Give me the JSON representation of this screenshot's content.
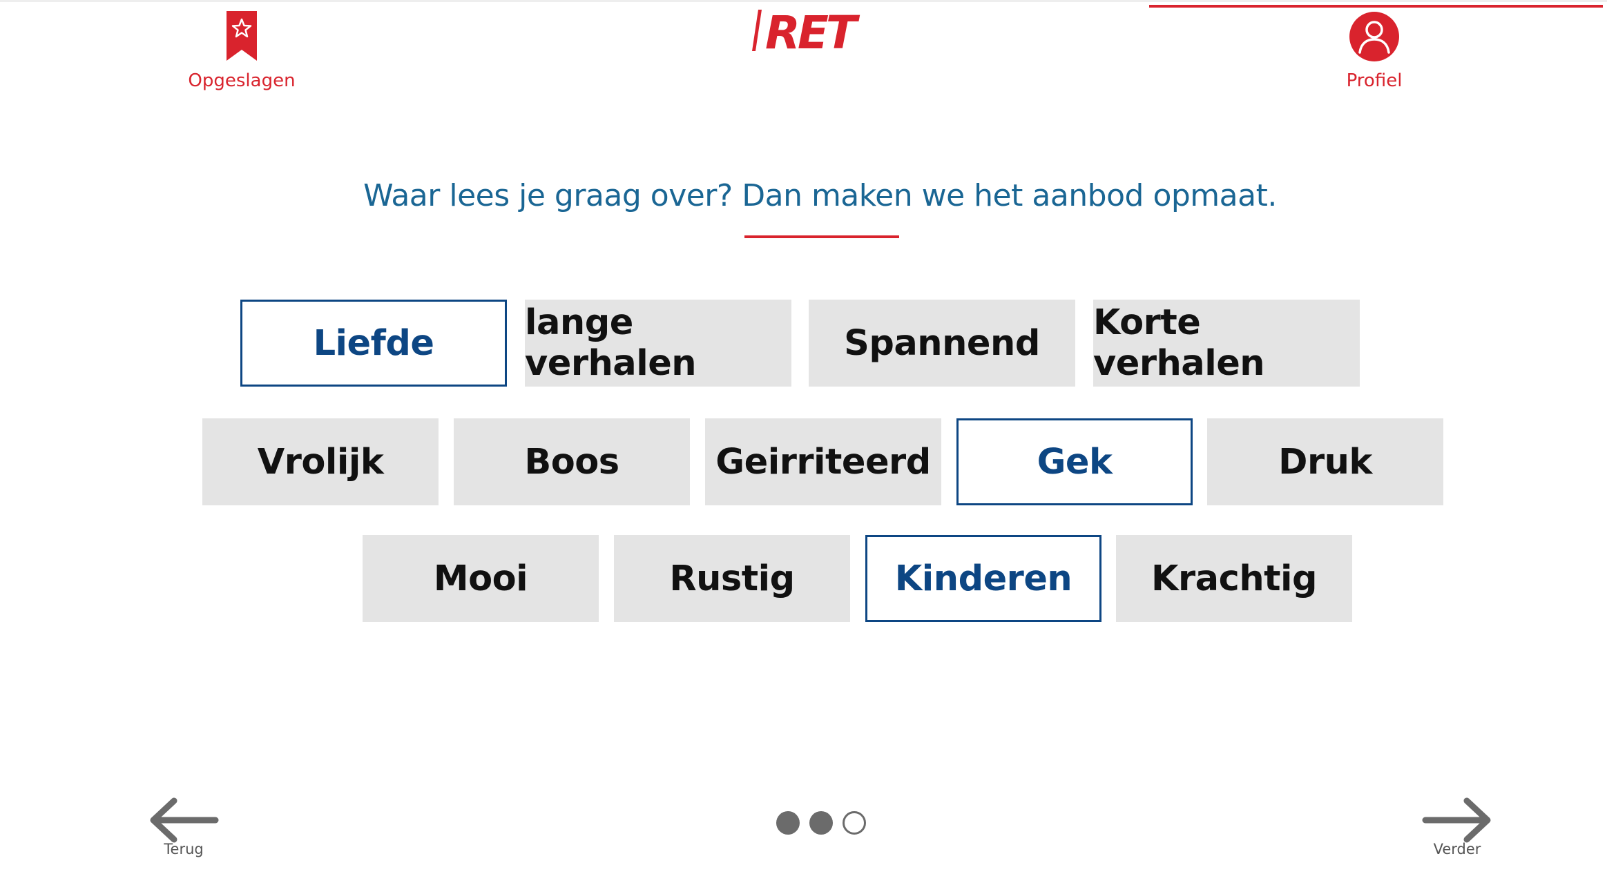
{
  "header": {
    "saved_label": "Opgeslagen",
    "profile_label": "Profiel",
    "logo_text": "RET"
  },
  "question": {
    "text": "Waar lees je graag over? Dan maken we het aanbod opmaat."
  },
  "topics": {
    "row1": [
      {
        "label": "Liefde",
        "selected": true
      },
      {
        "label": "lange verhalen",
        "selected": false
      },
      {
        "label": "Spannend",
        "selected": false
      },
      {
        "label": "Korte verhalen",
        "selected": false
      }
    ],
    "row2": [
      {
        "label": "Vrolijk",
        "selected": false
      },
      {
        "label": "Boos",
        "selected": false
      },
      {
        "label": "Geirriteerd",
        "selected": false
      },
      {
        "label": "Gek",
        "selected": true
      },
      {
        "label": "Druk",
        "selected": false
      }
    ],
    "row3": [
      {
        "label": "Mooi",
        "selected": false
      },
      {
        "label": "Rustig",
        "selected": false
      },
      {
        "label": "Kinderen",
        "selected": true
      },
      {
        "label": "Krachtig",
        "selected": false
      }
    ]
  },
  "navigation": {
    "back_label": "Terug",
    "next_label": "Verder",
    "progress": {
      "current_step": 2,
      "total_steps": 3
    }
  },
  "colors": {
    "brand_red": "#d9232d",
    "selected_blue": "#0d4683",
    "question_blue": "#1a6694",
    "chip_grey": "#e4e4e4",
    "nav_grey": "#6b6b6b"
  }
}
